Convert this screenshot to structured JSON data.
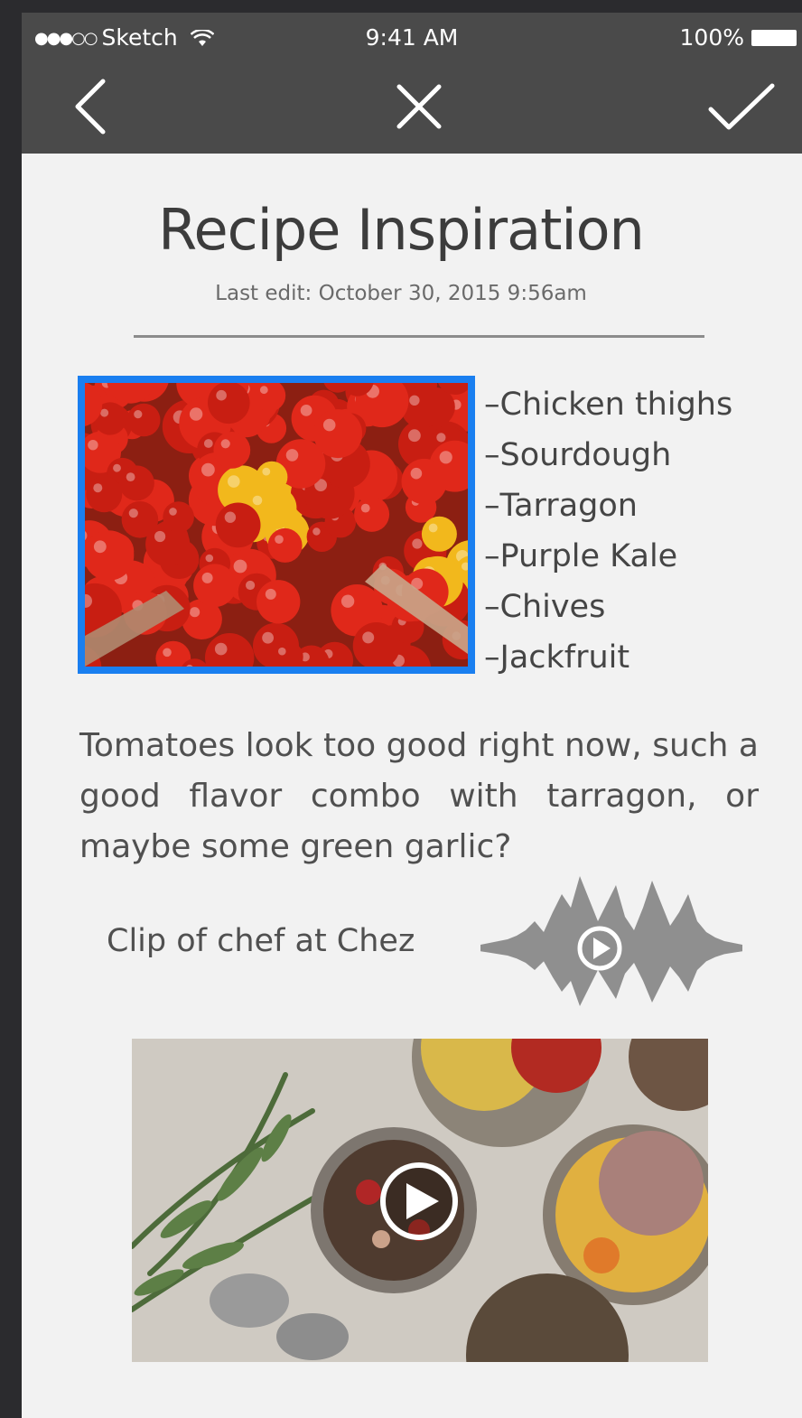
{
  "status_bar": {
    "carrier": "Sketch",
    "time": "9:41 AM",
    "battery": "100%"
  },
  "nav": {
    "back_icon": "chevron-left-icon",
    "close_icon": "close-icon",
    "done_icon": "checkmark-icon"
  },
  "note": {
    "title": "Recipe Inspiration",
    "last_edit": "Last edit: October 30, 2015 9:56am",
    "ingredients": [
      "–Chicken thighs",
      "–Sourdough",
      "–Tarragon",
      "–Purple Kale",
      "–Chives",
      "–Jackfruit"
    ],
    "body": "Tomatoes look too good right now, such a good flavor combo with tarragon, or maybe some green garlic?",
    "audio_label": "Clip of chef at Chez"
  },
  "colors": {
    "header_bg": "#4a4a4a",
    "page_bg": "#f2f2f2",
    "selection_border": "#1a7ff0",
    "waveform": "#8f8f8f"
  }
}
